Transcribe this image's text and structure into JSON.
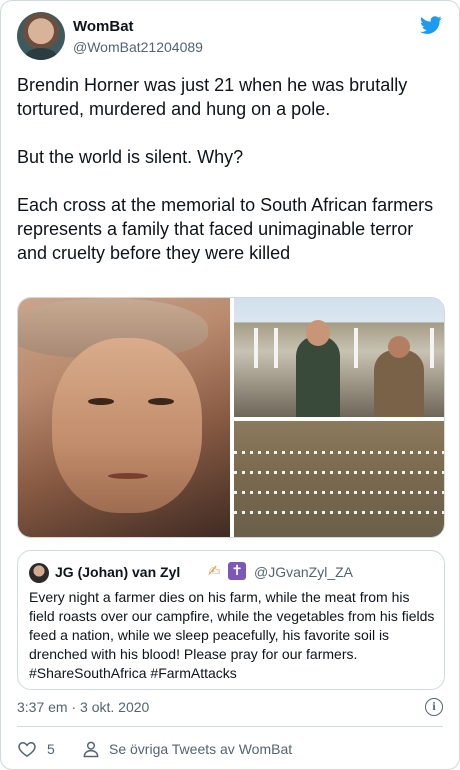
{
  "author": {
    "name": "WomBat",
    "handle": "@WomBat21204089"
  },
  "brand": {
    "icon": "twitter-bird-icon",
    "color": "#1d9bf0"
  },
  "tweet": {
    "text": "Brendin Horner was just 21 when he was brutally tortured, murdered and hung on a pole.\n\nBut the world is silent.  Why?\n\nEach cross at the memorial to South African farmers represents a family that faced unimaginable terror and cruelty before they were killed"
  },
  "quoted": {
    "name": "JG (Johan) van Zyl",
    "emoji": "✍",
    "cross_emoji": "✝",
    "handle": "@JGvanZyl_ZA",
    "text": "Every night a farmer dies on his farm, while the meat from his field roasts over our campfire, while the vegetables from his fields feed a nation, while we sleep peacefully, his favorite soil is drenched with his blood! Please pray for our farmers. #ShareSouthAfrica #FarmAttacks"
  },
  "meta": {
    "timestamp": "3:37 em · 3 okt. 2020",
    "info_icon": "i"
  },
  "actions": {
    "like_count": "5",
    "more_tweets": "Se övriga Tweets av WomBat"
  }
}
